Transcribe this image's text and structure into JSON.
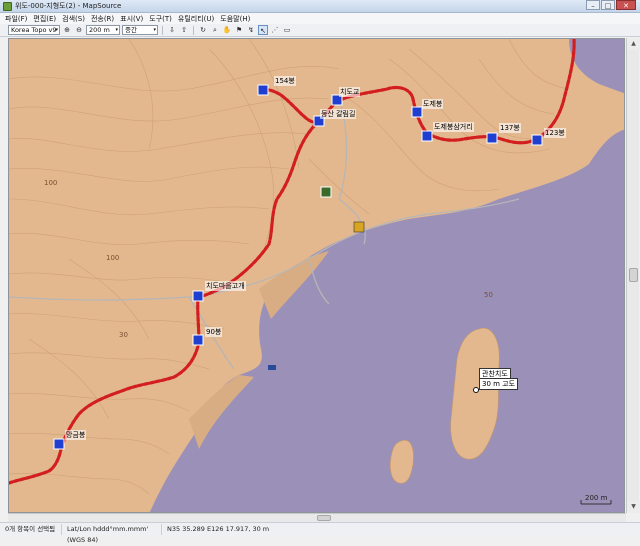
{
  "window": {
    "title": "위도-000-지형도(2) - MapSource",
    "minimize": "–",
    "maximize": "□",
    "close": "✕"
  },
  "menu": [
    "파일(F)",
    "편집(E)",
    "검색(S)",
    "전송(R)",
    "표시(V)",
    "도구(T)",
    "유틸리티(U)",
    "도움말(H)"
  ],
  "toolbar": {
    "map_product": "Korea Topo v9",
    "zoom_value": "200 m",
    "detail_value": "중간",
    "dropdown_glyph": "▾"
  },
  "map": {
    "water_color": "#9b91b8",
    "land_color": "#e3b88f",
    "track_color": "#d21e1e",
    "labels": {
      "peak_154": "154봉",
      "peak_top": "치도교",
      "dochi_peak": "도제봉",
      "dochi_junction": "도제봉삼거리",
      "peak_137": "137봉",
      "peak_123": "123봉",
      "parking": "등산 갈림길",
      "chido_pass": "치도마을고개",
      "peak_90": "90봉",
      "mangeum_peak": "망금봉",
      "island_name": "관찬치도",
      "island_alt": "30 m 고도",
      "scale": "200 m",
      "contour_100_a": "100",
      "contour_100_b": "100",
      "contour_30": "30",
      "contour_50": "50"
    }
  },
  "status": {
    "selection": "0개 항목이 선택됨",
    "format": "Lat/Lon hddd°mm.mmm' (WGS 84)",
    "coords": "N35 35.289 E126 17.917, 30 m"
  }
}
